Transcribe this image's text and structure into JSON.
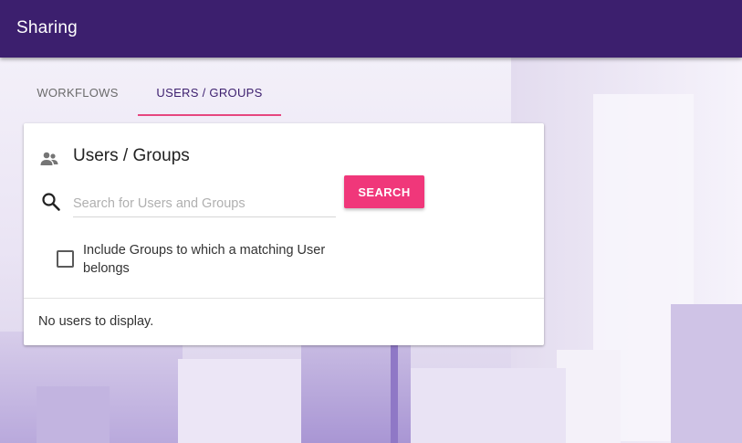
{
  "app_bar": {
    "title": "Sharing"
  },
  "tabs": [
    {
      "label": "WORKFLOWS",
      "active": false
    },
    {
      "label": "USERS / GROUPS",
      "active": true
    }
  ],
  "card": {
    "title": "Users / Groups",
    "title_icon": "people-icon",
    "search": {
      "icon": "search-icon",
      "value": "",
      "placeholder": "Search for Users and Groups"
    },
    "search_button_label": "SEARCH",
    "include_groups": {
      "checked": false,
      "label": "Include Groups to which a matching User belongs"
    },
    "empty_message": "No users to display."
  },
  "colors": {
    "app_bar": "#3c1f6e",
    "accent": "#f0377a",
    "tab_indicator": "#e6467f",
    "active_tab_text": "#3c1f6e"
  }
}
